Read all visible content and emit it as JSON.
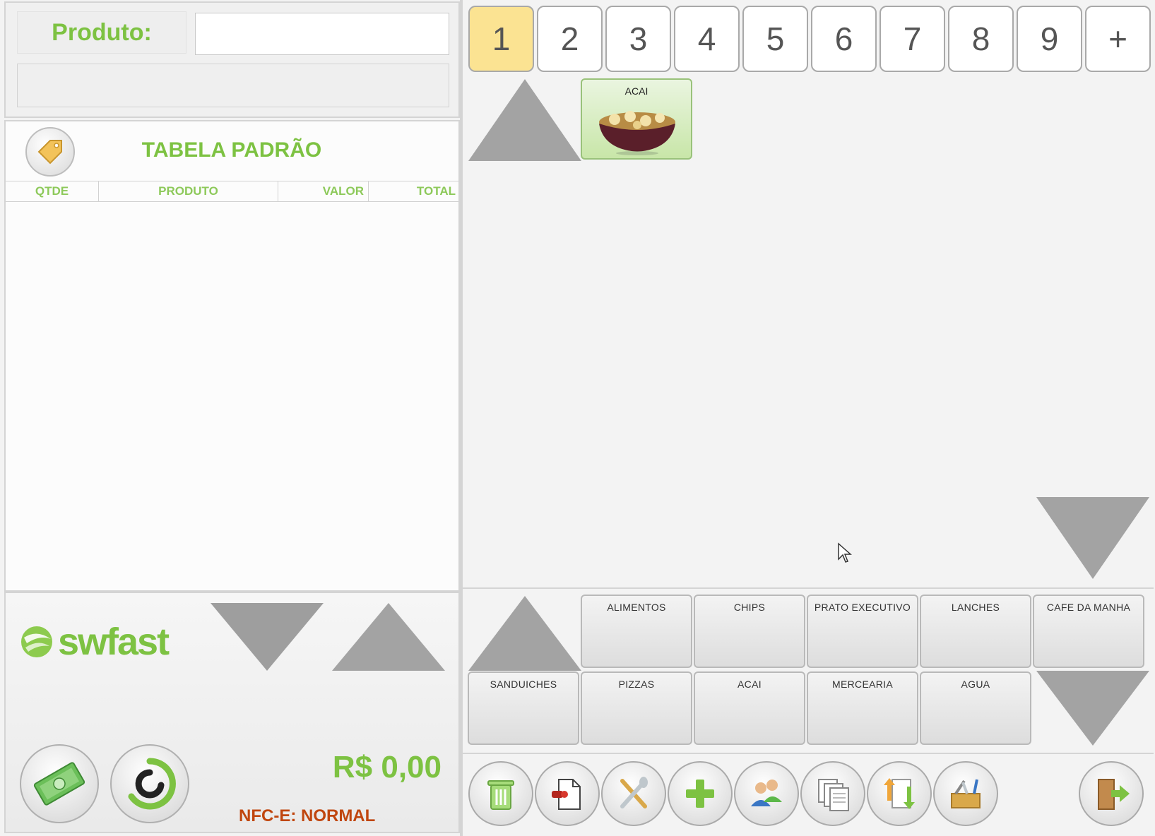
{
  "produto": {
    "label": "Produto:",
    "input_value": "",
    "description": ""
  },
  "cart": {
    "table_name": "TABELA PADRÃO",
    "columns": [
      "QTDE",
      "PRODUTO",
      "VALOR",
      "TOTAL"
    ],
    "rows": []
  },
  "footer": {
    "logo_text": "swfast",
    "total": "R$ 0,00",
    "nfce_status": "NFC-E: NORMAL"
  },
  "page_tabs": {
    "items": [
      "1",
      "2",
      "3",
      "4",
      "5",
      "6",
      "7",
      "8",
      "9",
      "+"
    ],
    "active": "1"
  },
  "products": [
    {
      "label": "ACAI",
      "icon": "acai-bowl-image"
    }
  ],
  "categories": {
    "row1": [
      "ALIMENTOS",
      "CHIPS",
      "PRATO EXECUTIVO",
      "LANCHES",
      "CAFE DA MANHA"
    ],
    "row2": [
      "SANDUICHES",
      "PIZZAS",
      "ACAI",
      "MERCEARIA",
      "AGUA"
    ]
  },
  "toolbar": [
    "trash-icon",
    "document-export-icon",
    "cutlery-icon",
    "plus-icon",
    "customers-icon",
    "copy-documents-icon",
    "transfer-icon",
    "toolbox-icon",
    "exit-door-icon"
  ],
  "colors": {
    "brand_green": "#7dc242",
    "active_tab": "#fbe392",
    "nfce_red": "#c0460f",
    "triangle_gray": "#a3a3a3"
  }
}
